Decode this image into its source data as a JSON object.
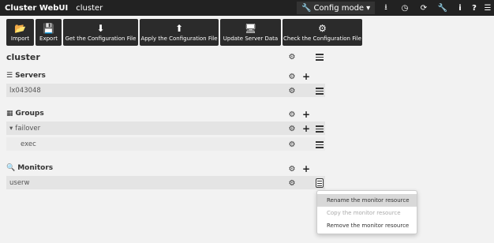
{
  "navbar": {
    "brand": "Cluster WebUI",
    "cluster_name": "cluster",
    "mode_label": "Config mode",
    "icons": [
      "download-icon",
      "history-icon",
      "refresh-icon",
      "wrench-icon",
      "info-icon",
      "question-icon",
      "list-icon"
    ]
  },
  "toolbar": {
    "import": "Import",
    "export": "Export",
    "get_config": "Get the Configuration File",
    "apply_config": "Apply the Configuration File",
    "update_server": "Update Server Data",
    "check_config": "Check the Configuration File"
  },
  "page": {
    "title": "cluster"
  },
  "servers": {
    "title": "Servers",
    "items": [
      {
        "label": "lx043048"
      }
    ]
  },
  "groups": {
    "title": "Groups",
    "items": [
      {
        "label": "failover"
      },
      {
        "label": "exec"
      }
    ]
  },
  "monitors": {
    "title": "Monitors",
    "items": [
      {
        "label": "userw"
      }
    ]
  },
  "context_menu": {
    "rename": "Rename the monitor resource",
    "copy": "Copy the monitor resource",
    "remove": "Remove the monitor resource"
  }
}
